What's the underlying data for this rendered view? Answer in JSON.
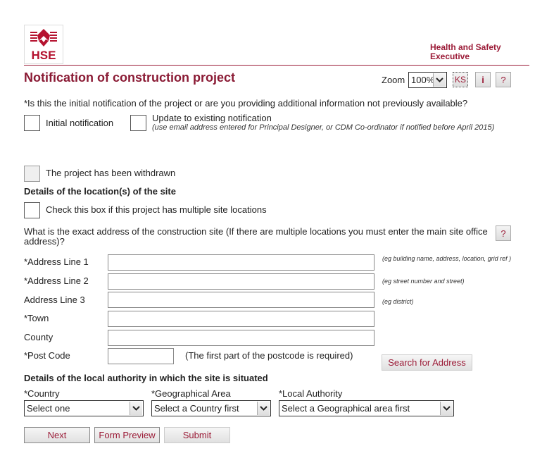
{
  "header": {
    "logo_text": "HSE",
    "org_line1": "Health and Safety",
    "org_line2": "Executive",
    "page_title": "Notification of construction project",
    "zoom_label": "Zoom",
    "zoom_value": "100%",
    "ks_label": "KS",
    "info_label": "i",
    "help_label": "?"
  },
  "notification": {
    "question": "*Is this the initial notification of the project or are you providing additional information not previously available?",
    "initial_label": "Initial notification",
    "update_label": "Update to existing notification",
    "update_note": "(use email address entered for Principal Designer, or CDM Co-ordinator if notified before April 2015)",
    "withdrawn_label": "The project has been withdrawn"
  },
  "location": {
    "heading": "Details of the location(s) of the site",
    "multiple_label": "Check this box if this project has multiple site locations",
    "address_question": "What is the exact address of the construction site (If there are multiple locations you must enter the main site office address)?",
    "help_label": "?",
    "fields": [
      {
        "label": "*Address Line 1",
        "value": "",
        "hint": "(eg building name, address, location, grid ref )"
      },
      {
        "label": "*Address Line 2",
        "value": "",
        "hint": "(eg street number and street)"
      },
      {
        "label": "Address Line 3",
        "value": "",
        "hint": "(eg district)"
      },
      {
        "label": "*Town",
        "value": "",
        "hint": ""
      },
      {
        "label": "County",
        "value": "",
        "hint": ""
      }
    ],
    "postcode_label": "*Post Code",
    "postcode_value": "",
    "postcode_note": "(The first part of the postcode is required)",
    "search_button": "Search for Address"
  },
  "authority": {
    "heading": "Details of the local authority in which the site is situated",
    "country_label": "*Country",
    "country_value": "Select one",
    "area_label": "*Geographical Area",
    "area_value": "Select a Country first",
    "authority_label": "*Local Authority",
    "authority_value": "Select a Geographical area first"
  },
  "actions": {
    "next": "Next",
    "preview": "Form Preview",
    "submit": "Submit"
  }
}
